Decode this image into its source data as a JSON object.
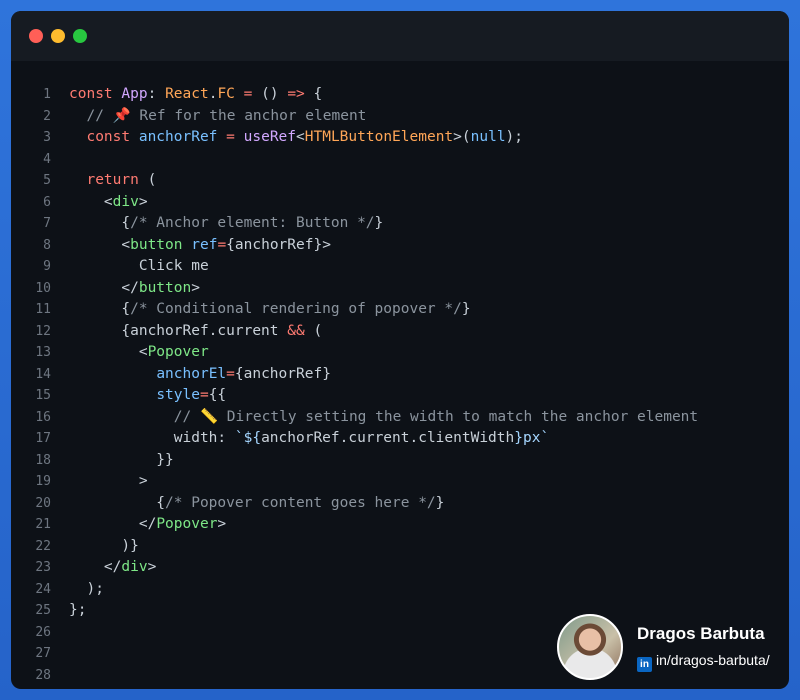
{
  "window": {
    "title": ""
  },
  "code": {
    "lines": [
      [
        {
          "t": "const",
          "c": "kw"
        },
        {
          "t": " ",
          "c": "pn"
        },
        {
          "t": "App",
          "c": "fn"
        },
        {
          "t": ": ",
          "c": "pn"
        },
        {
          "t": "React",
          "c": "ty"
        },
        {
          "t": ".",
          "c": "pn"
        },
        {
          "t": "FC",
          "c": "ty"
        },
        {
          "t": " = ",
          "c": "kw"
        },
        {
          "t": "() ",
          "c": "pn"
        },
        {
          "t": "=>",
          "c": "kw"
        },
        {
          "t": " {",
          "c": "pn"
        }
      ],
      [
        {
          "t": "  // 📌 Ref for the anchor element",
          "c": "cm"
        }
      ],
      [
        {
          "t": "  const",
          "c": "kw"
        },
        {
          "t": " ",
          "c": "pn"
        },
        {
          "t": "anchorRef",
          "c": "var"
        },
        {
          "t": " = ",
          "c": "kw"
        },
        {
          "t": "useRef",
          "c": "fn"
        },
        {
          "t": "<",
          "c": "pn"
        },
        {
          "t": "HTMLButtonElement",
          "c": "ty"
        },
        {
          "t": ">(",
          "c": "pn"
        },
        {
          "t": "null",
          "c": "var"
        },
        {
          "t": ");",
          "c": "pn"
        }
      ],
      [],
      [
        {
          "t": "  return",
          "c": "kw"
        },
        {
          "t": " (",
          "c": "pn"
        }
      ],
      [
        {
          "t": "    <",
          "c": "pn"
        },
        {
          "t": "div",
          "c": "tag"
        },
        {
          "t": ">",
          "c": "pn"
        }
      ],
      [
        {
          "t": "      {",
          "c": "pn"
        },
        {
          "t": "/* Anchor element: Button */",
          "c": "cm"
        },
        {
          "t": "}",
          "c": "pn"
        }
      ],
      [
        {
          "t": "      <",
          "c": "pn"
        },
        {
          "t": "button",
          "c": "tag"
        },
        {
          "t": " ",
          "c": "pn"
        },
        {
          "t": "ref",
          "c": "attr"
        },
        {
          "t": "=",
          "c": "kw"
        },
        {
          "t": "{anchorRef}>",
          "c": "pn"
        }
      ],
      [
        {
          "t": "        Click me",
          "c": "pn"
        }
      ],
      [
        {
          "t": "      </",
          "c": "pn"
        },
        {
          "t": "button",
          "c": "tag"
        },
        {
          "t": ">",
          "c": "pn"
        }
      ],
      [
        {
          "t": "      {",
          "c": "pn"
        },
        {
          "t": "/* Conditional rendering of popover */",
          "c": "cm"
        },
        {
          "t": "}",
          "c": "pn"
        }
      ],
      [
        {
          "t": "      {anchorRef.current ",
          "c": "pn"
        },
        {
          "t": "&&",
          "c": "kw"
        },
        {
          "t": " (",
          "c": "pn"
        }
      ],
      [
        {
          "t": "        <",
          "c": "pn"
        },
        {
          "t": "Popover",
          "c": "tag"
        }
      ],
      [
        {
          "t": "          ",
          "c": "pn"
        },
        {
          "t": "anchorEl",
          "c": "attr"
        },
        {
          "t": "=",
          "c": "kw"
        },
        {
          "t": "{anchorRef}",
          "c": "pn"
        }
      ],
      [
        {
          "t": "          ",
          "c": "pn"
        },
        {
          "t": "style",
          "c": "attr"
        },
        {
          "t": "=",
          "c": "kw"
        },
        {
          "t": "{{",
          "c": "pn"
        }
      ],
      [
        {
          "t": "            // 📏 Directly setting the width to match the anchor element",
          "c": "cm"
        }
      ],
      [
        {
          "t": "            width: ",
          "c": "pn"
        },
        {
          "t": "`${",
          "c": "str"
        },
        {
          "t": "anchorRef.current.clientWidth",
          "c": "pn"
        },
        {
          "t": "}px`",
          "c": "str"
        }
      ],
      [
        {
          "t": "          }}",
          "c": "pn"
        }
      ],
      [
        {
          "t": "        >",
          "c": "pn"
        }
      ],
      [
        {
          "t": "          {",
          "c": "pn"
        },
        {
          "t": "/* Popover content goes here */",
          "c": "cm"
        },
        {
          "t": "}",
          "c": "pn"
        }
      ],
      [
        {
          "t": "        </",
          "c": "pn"
        },
        {
          "t": "Popover",
          "c": "tag"
        },
        {
          "t": ">",
          "c": "pn"
        }
      ],
      [
        {
          "t": "      )}",
          "c": "pn"
        }
      ],
      [
        {
          "t": "    </",
          "c": "pn"
        },
        {
          "t": "div",
          "c": "tag"
        },
        {
          "t": ">",
          "c": "pn"
        }
      ],
      [
        {
          "t": "  );",
          "c": "pn"
        }
      ],
      [
        {
          "t": "};",
          "c": "pn"
        }
      ],
      [],
      [],
      []
    ]
  },
  "author": {
    "name": "Dragos Barbuta",
    "linkedin_icon": "in",
    "handle": "in/dragos-barbuta/"
  },
  "colors": {
    "background": "#2a6fd6",
    "editor": "#0d1117",
    "keyword": "#ff7b72",
    "function": "#d2a8ff",
    "type": "#ffa657",
    "variable": "#79c0ff",
    "comment": "#8b949e",
    "tag": "#7ee787"
  }
}
